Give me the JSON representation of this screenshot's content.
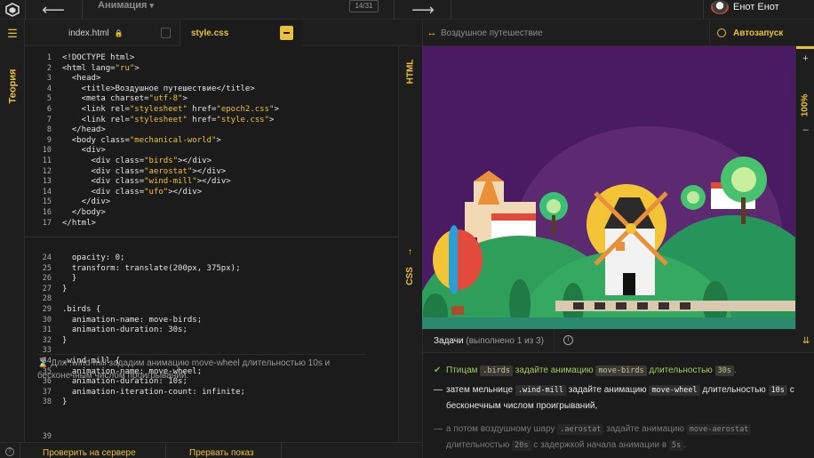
{
  "header": {
    "course_title": "Анимация",
    "step_counter": "14/31",
    "user_name": "Енот Енот"
  },
  "left_rail": {
    "theory_label": "Теория"
  },
  "tabs": [
    {
      "label": "index.html",
      "active": false,
      "locked": true
    },
    {
      "label": "style.css",
      "active": true,
      "locked": false
    }
  ],
  "editor": {
    "html_label": "HTML",
    "css_label": "CSS",
    "html_lines": [
      {
        "n": "1",
        "code": "<!DOCTYPE html>"
      },
      {
        "n": "2",
        "code": "<html lang=\"ru\">"
      },
      {
        "n": "3",
        "code": "  <head>"
      },
      {
        "n": "4",
        "code": "    <title>Воздушное путешествие</title>"
      },
      {
        "n": "5",
        "code": "    <meta charset=\"utf-8\">"
      },
      {
        "n": "6",
        "code": "    <link rel=\"stylesheet\" href=\"epoch2.css\">"
      },
      {
        "n": "7",
        "code": "    <link rel=\"stylesheet\" href=\"style.css\">"
      },
      {
        "n": "8",
        "code": "  </head>"
      },
      {
        "n": "9",
        "code": "  <body class=\"mechanical-world\">"
      },
      {
        "n": "10",
        "code": "    <div>"
      },
      {
        "n": "11",
        "code": "      <div class=\"birds\"></div>"
      },
      {
        "n": "12",
        "code": "      <div class=\"aerostat\"></div>"
      },
      {
        "n": "13",
        "code": "      <div class=\"wind-mill\"></div>"
      },
      {
        "n": "14",
        "code": "      <div class=\"ufo\"></div>"
      },
      {
        "n": "15",
        "code": "    </div>"
      },
      {
        "n": "16",
        "code": "  </body>"
      },
      {
        "n": "17",
        "code": "</html>"
      }
    ],
    "css_lines": [
      {
        "n": "24",
        "code": "  opacity: 0;"
      },
      {
        "n": "25",
        "code": "  transform: translate(200px, 375px);"
      },
      {
        "n": "26",
        "code": "  }"
      },
      {
        "n": "27",
        "code": "}"
      },
      {
        "n": "28",
        "code": ""
      },
      {
        "n": "29",
        "code": ".birds {"
      },
      {
        "n": "30",
        "code": "  animation-name: move-birds;"
      },
      {
        "n": "31",
        "code": "  animation-duration: 30s;"
      },
      {
        "n": "32",
        "code": "}"
      },
      {
        "n": "33",
        "code": ""
      },
      {
        "n": "34",
        "code": ".wind-mill {"
      },
      {
        "n": "35",
        "code": "  animation-name: move-wheel;"
      },
      {
        "n": "36",
        "code": "  animation-duration: 10s;"
      },
      {
        "n": "37",
        "code": "  animation-iteration-count: infinite;"
      },
      {
        "n": "38",
        "code": "}"
      }
    ],
    "line_39": "39",
    "hint_text": "Для .wind-mill зададим анимацию move-wheel длительностью 10s и бесконечным числом проигрываний."
  },
  "bottom_bar": {
    "check_button": "Проверить на сервере",
    "stop_button": "Прервать показ"
  },
  "preview": {
    "title": "Воздушное путешествие",
    "autorun_label": "Автозапуск",
    "zoom_level": "100%"
  },
  "tasks": {
    "title": "Задачи",
    "progress": "(выполнено 1 из 3)",
    "items": [
      {
        "state": "done",
        "parts": [
          "Птицам ",
          ".birds",
          " задайте анимацию ",
          "move-birds",
          " длительностью ",
          "30s",
          "."
        ]
      },
      {
        "state": "current",
        "parts": [
          "затем мельнице ",
          ".wind-mill",
          " задайте анимацию ",
          "move-wheel",
          " длительностью ",
          "10s",
          " с бесконечным числом проигрываний,"
        ]
      },
      {
        "state": "future",
        "parts": [
          "а потом воздушному шару ",
          ".aerostat",
          " задайте анимацию ",
          "move-aerostat",
          " длительностью ",
          "20s",
          " с задержкой начала анимации в ",
          "5s",
          "."
        ]
      }
    ]
  },
  "colors": {
    "accent": "#e8c23a",
    "background": "#1b1b1b",
    "scene_sky": "#4a1b63",
    "done_green": "#a9c85a"
  }
}
